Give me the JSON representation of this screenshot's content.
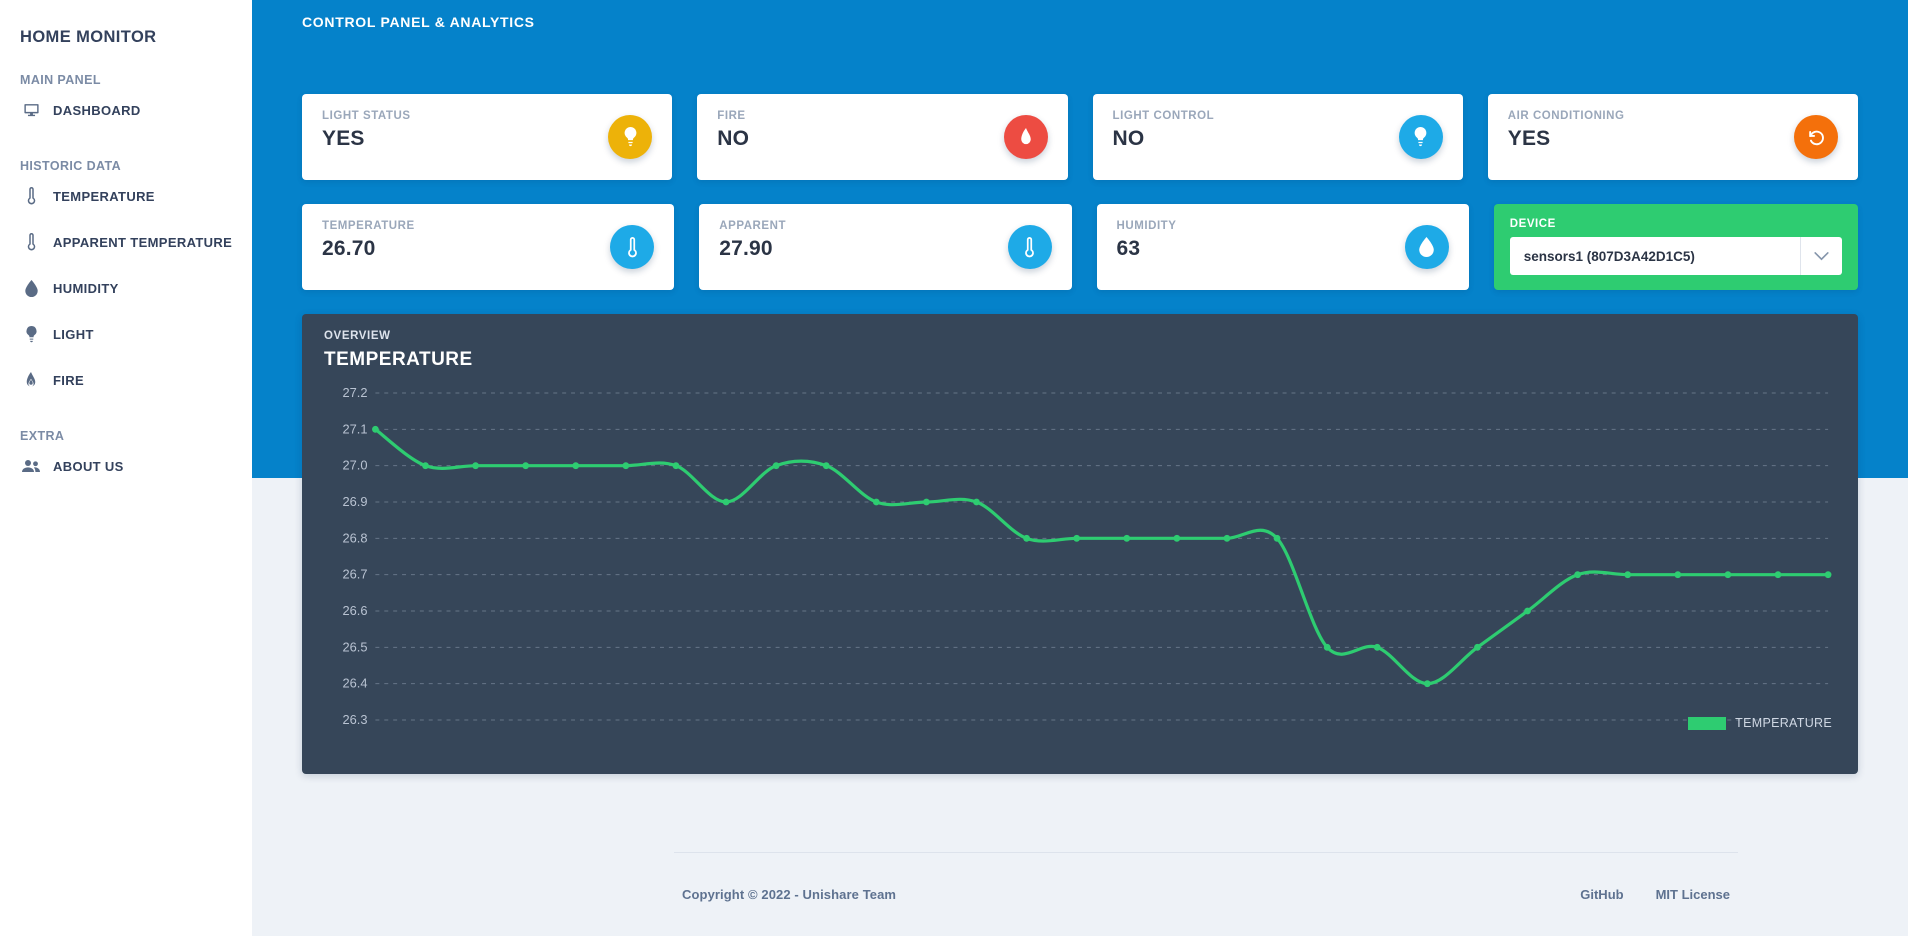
{
  "sidebar": {
    "brand": "HOME MONITOR",
    "sections": [
      {
        "heading": "MAIN PANEL",
        "items": [
          {
            "label": "DASHBOARD",
            "icon": "monitor-icon"
          }
        ]
      },
      {
        "heading": "HISTORIC DATA",
        "items": [
          {
            "label": "TEMPERATURE",
            "icon": "thermometer-icon"
          },
          {
            "label": "APPARENT TEMPERATURE",
            "icon": "thermometer-icon"
          },
          {
            "label": "HUMIDITY",
            "icon": "droplet-icon"
          },
          {
            "label": "LIGHT",
            "icon": "lightbulb-icon"
          },
          {
            "label": "FIRE",
            "icon": "flame-icon"
          }
        ]
      },
      {
        "heading": "EXTRA",
        "items": [
          {
            "label": "ABOUT US",
            "icon": "people-icon"
          }
        ]
      }
    ]
  },
  "header": {
    "title": "CONTROL PANEL & ANALYTICS"
  },
  "cards_row1": [
    {
      "label": "LIGHT STATUS",
      "value": "YES",
      "icon": "lightbulb-icon",
      "color": "#edb209"
    },
    {
      "label": "FIRE",
      "value": "NO",
      "icon": "flame-icon",
      "color": "#ed4c42"
    },
    {
      "label": "LIGHT CONTROL",
      "value": "NO",
      "icon": "lightbulb-icon",
      "color": "#1eaae7"
    },
    {
      "label": "AIR CONDITIONING",
      "value": "YES",
      "icon": "rotate-left-icon",
      "color": "#f4700b"
    }
  ],
  "cards_row2": [
    {
      "label": "TEMPERATURE",
      "value": "26.70",
      "icon": "thermometer-icon",
      "color": "#1eaae7"
    },
    {
      "label": "APPARENT",
      "value": "27.90",
      "icon": "thermometer-icon",
      "color": "#1eaae7"
    },
    {
      "label": "HUMIDITY",
      "value": "63",
      "icon": "droplet-icon",
      "color": "#1eaae7"
    }
  ],
  "device_card": {
    "label": "DEVICE",
    "selected": "sensors1 (807D3A42D1C5)",
    "caret_icon": "chevron-down-icon",
    "background": "#2ecc71"
  },
  "chart_panel": {
    "subtitle": "OVERVIEW",
    "title": "TEMPERATURE"
  },
  "chart_data": {
    "type": "line",
    "title": "TEMPERATURE",
    "subtitle": "OVERVIEW",
    "xlabel": "",
    "ylabel": "",
    "ylim": [
      26.25,
      27.25
    ],
    "yticks": [
      27.2,
      27.1,
      27.0,
      26.9,
      26.8,
      26.7,
      26.6,
      26.5,
      26.4,
      26.3
    ],
    "grid": true,
    "legend_position": "bottom-right",
    "line_color": "#2ecc71",
    "series": [
      {
        "name": "TEMPERATURE",
        "values": [
          27.1,
          27.0,
          27.0,
          27.0,
          27.0,
          27.0,
          27.0,
          26.9,
          27.0,
          27.0,
          26.9,
          26.9,
          26.9,
          26.8,
          26.8,
          26.8,
          26.8,
          26.8,
          26.8,
          26.5,
          26.5,
          26.4,
          26.5,
          26.6,
          26.7,
          26.7,
          26.7,
          26.7,
          26.7,
          26.7
        ]
      }
    ]
  },
  "footer": {
    "copyright": "Copyright © 2022 - Unishare Team",
    "links": [
      {
        "label": "GitHub"
      },
      {
        "label": "MIT License"
      }
    ]
  }
}
